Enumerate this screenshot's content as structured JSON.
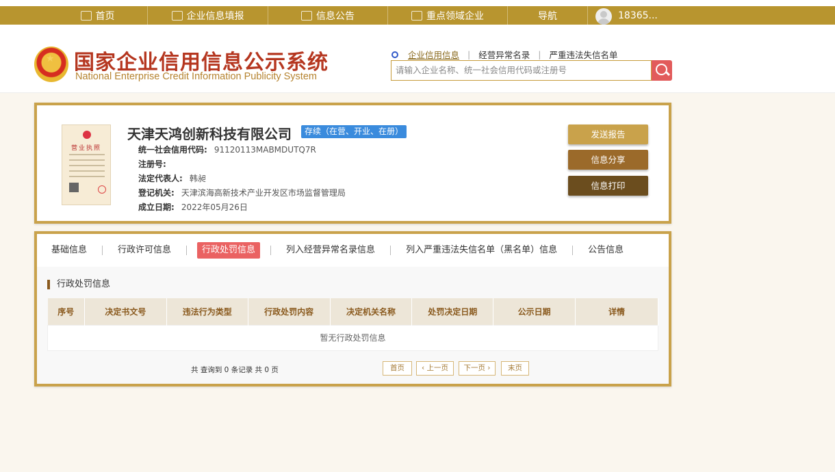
{
  "nav": {
    "items": [
      "首页",
      "企业信息填报",
      "信息公告",
      "重点领域企业",
      "导航"
    ],
    "user": "18365..."
  },
  "header": {
    "title": "国家企业信用信息公示系统",
    "subtitle": "National Enterprise Credit Information Publicity System",
    "search_tabs": [
      "企业信用信息",
      "经营异常名录",
      "严重违法失信名单"
    ],
    "search_placeholder": "请输入企业名称、统一社会信用代码或注册号"
  },
  "company": {
    "license_label": "营业执照",
    "name": "天津天鸿创新科技有限公司",
    "status": "存续（在营、开业、在册）",
    "fields": [
      {
        "label": "统一社会信用代码:",
        "value": "91120113MABMDUTQ7R"
      },
      {
        "label": "注册号:",
        "value": ""
      },
      {
        "label": "法定代表人:",
        "value": "韩昶"
      },
      {
        "label": "登记机关:",
        "value": "天津滨海高新技术产业开发区市场监督管理局"
      },
      {
        "label": "成立日期:",
        "value": "2022年05月26日"
      }
    ],
    "buttons": {
      "send": "发送报告",
      "share": "信息分享",
      "print": "信息打印"
    }
  },
  "tabs": [
    "基础信息",
    "行政许可信息",
    "行政处罚信息",
    "列入经营异常名录信息",
    "列入严重违法失信名单（黑名单）信息",
    "公告信息"
  ],
  "active_tab": "行政处罚信息",
  "section": {
    "title": "行政处罚信息",
    "columns": [
      "序号",
      "决定书文号",
      "违法行为类型",
      "行政处罚内容",
      "决定机关名称",
      "处罚决定日期",
      "公示日期",
      "详情"
    ],
    "empty": "暂无行政处罚信息"
  },
  "pager": {
    "info": "共 查询到 0 条记录 共 0 页",
    "first": "首页",
    "prev": "上一页",
    "next": "下一页",
    "last": "末页"
  },
  "colors": {
    "nav": "#b8952f",
    "accent": "#c9a24b",
    "active_tab": "#ea6262",
    "status": "#3a8bdd"
  }
}
